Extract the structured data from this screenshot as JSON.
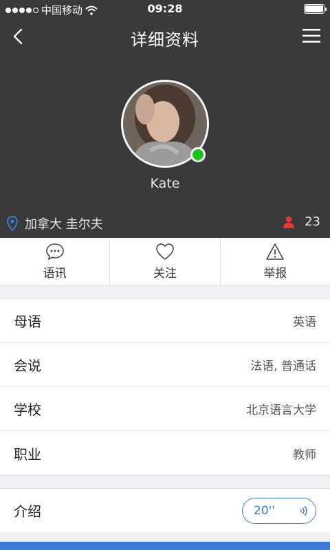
{
  "status_bar": {
    "carrier": "中国移动",
    "time": "09:28"
  },
  "nav": {
    "title": "详细资料",
    "back_icon": "chevron-left-icon",
    "menu_icon": "hamburger-menu-icon"
  },
  "profile": {
    "name": "Kate",
    "location": "加拿大 圭尔夫",
    "followers": "23",
    "online_color": "#18c31a"
  },
  "actions": [
    {
      "label": "语讯",
      "icon": "chat-bubble-icon"
    },
    {
      "label": "关注",
      "icon": "heart-icon"
    },
    {
      "label": "举报",
      "icon": "warning-icon"
    }
  ],
  "details": [
    {
      "label": "母语",
      "value": "英语"
    },
    {
      "label": "会说",
      "value": "法语, 普通话"
    },
    {
      "label": "学校",
      "value": "北京语言大学"
    },
    {
      "label": "职业",
      "value": "教师"
    }
  ],
  "intro": {
    "label": "介绍",
    "voice_duration": "20''"
  },
  "colors": {
    "header_bg": "#3a3a3c",
    "accent": "#3a7bd5",
    "online": "#18c31a",
    "follower_icon": "#e53935"
  }
}
